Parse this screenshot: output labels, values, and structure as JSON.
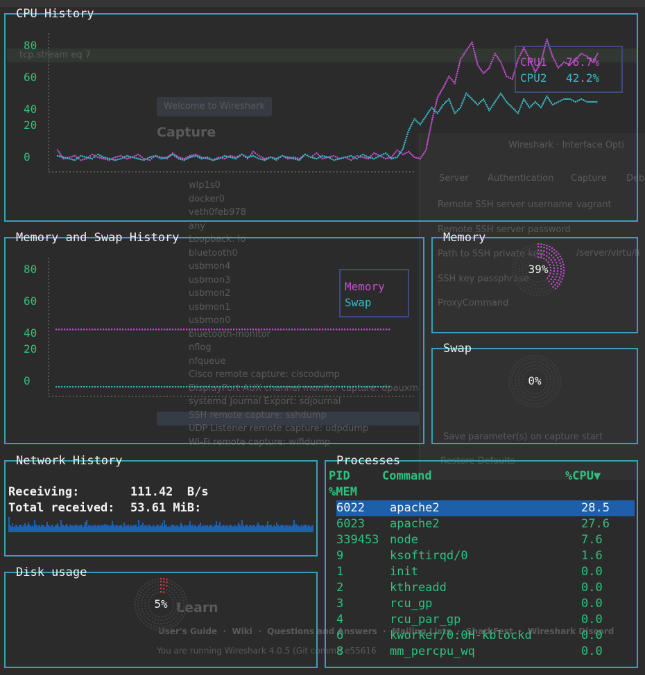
{
  "background_app": {
    "filter_text": "tcp.stream eq 7",
    "welcome": "Welcome to Wireshark",
    "capture_heading": "Capture",
    "learn_heading": "Learn",
    "learn_links": "User's Guide  ·  Wiki  ·  Questions and Answers  ·  Mailing Lists  ·  SharkFest  ·  Wireshark Discord",
    "version_text": "You are running Wireshark 4.0.5 (Git commit e55616",
    "interfaces": [
      "wlp1s0",
      "docker0",
      "veth0feb978",
      "any",
      "Loopback: lo",
      "bluetooth0",
      "usbmon4",
      "usbmon3",
      "usbmon2",
      "usbmon1",
      "usbmon0",
      "bluetooth-monitor",
      "nflog",
      "nfqueue",
      "Cisco remote capture: ciscodump",
      "DisplayPort AUX channel monitor capture: dpauxmon",
      "systemd Journal Export: sdjournal",
      "SSH remote capture: sshdump",
      "UDP Listener remote capture: udpdump",
      "Wi-Fi remote capture: wifidump"
    ],
    "dialog": {
      "title": "Wireshark · Interface Opti",
      "tabs": [
        "Server",
        "Authentication",
        "Capture",
        "Deb"
      ],
      "fields": [
        "Remote SSH server username",
        "Remote SSH server password",
        "Path to SSH private key",
        "SSH key passphrase",
        "ProxyCommand"
      ],
      "username_value": "vagrant",
      "key_path_value": "/server/virtu/li",
      "save_params": "Save parameter(s) on capture start",
      "restore": "Restore Defaults"
    }
  },
  "cpu_history": {
    "title": "CPU History",
    "ticks": [
      "80",
      "60",
      "40",
      "20",
      "0"
    ],
    "legend": [
      {
        "name": "CPU1",
        "value": "76.7%",
        "color": "#c44fd1"
      },
      {
        "name": "CPU2",
        "value": "42.2%",
        "color": "#3bb9c9"
      }
    ],
    "series": {
      "cpu1": [
        8,
        2,
        3,
        4,
        1,
        2,
        5,
        3,
        2,
        1,
        3,
        4,
        2,
        3,
        5,
        2,
        1,
        4,
        3,
        2,
        6,
        3,
        2,
        4,
        5,
        3,
        2,
        1,
        3,
        2,
        4,
        3,
        5,
        2,
        7,
        4,
        2,
        3,
        1,
        4,
        2,
        3,
        2,
        5,
        3,
        6,
        2,
        3,
        4,
        2,
        3,
        1,
        4,
        3,
        2,
        6,
        4,
        2,
        3,
        8,
        5,
        7,
        3,
        2,
        8,
        28,
        45,
        52,
        60,
        55,
        72,
        78,
        84,
        68,
        62,
        66,
        76,
        70,
        60,
        58,
        72,
        80,
        72,
        63,
        70,
        86,
        74,
        66,
        70,
        68,
        72,
        76,
        74,
        70,
        77
      ],
      "cpu2": [
        4,
        3,
        2,
        1,
        4,
        3,
        2,
        5,
        3,
        2,
        1,
        2,
        4,
        3,
        2,
        1,
        3,
        4,
        2,
        3,
        5,
        2,
        1,
        3,
        4,
        2,
        3,
        1,
        2,
        4,
        3,
        2,
        5,
        3,
        4,
        2,
        1,
        3,
        2,
        4,
        3,
        2,
        1,
        5,
        3,
        2,
        4,
        3,
        1,
        2,
        3,
        4,
        2,
        5,
        3,
        2,
        4,
        6,
        2,
        3,
        9,
        22,
        30,
        26,
        32,
        38,
        34,
        40,
        44,
        34,
        38,
        48,
        44,
        40,
        44,
        36,
        42,
        48,
        42,
        38,
        34,
        44,
        38,
        42,
        38,
        46,
        40,
        42,
        44,
        44,
        42,
        44,
        42,
        42,
        42
      ]
    }
  },
  "memory_history": {
    "title": "Memory and Swap History",
    "ticks": [
      "80",
      "60",
      "40",
      "20",
      "0"
    ],
    "legend": [
      {
        "name": "Memory",
        "color": "#c44fd1"
      },
      {
        "name": "Swap",
        "color": "#3bb9c9"
      }
    ],
    "memory_level": 39,
    "swap_level": 0
  },
  "memory": {
    "title": "Memory",
    "percent": "39%",
    "fraction": 0.39
  },
  "swap": {
    "title": "Swap",
    "percent": "0%",
    "fraction": 0.0
  },
  "network": {
    "title": "Network History",
    "receiving_label": "Receiving:",
    "receiving_value": "111.42  B/s",
    "total_label": "Total received:",
    "total_value": "53.61 MiB:",
    "bars": [
      6,
      6,
      5,
      8,
      5,
      5,
      7,
      6,
      5,
      6,
      7,
      6,
      5,
      6,
      8,
      5,
      6,
      6,
      7,
      6,
      5,
      6,
      5,
      6,
      7,
      5,
      6,
      6,
      5,
      7,
      6,
      6,
      5,
      6,
      7,
      6,
      6,
      5,
      7,
      6,
      5,
      6,
      7,
      8,
      6,
      5,
      6,
      6,
      7,
      5,
      6,
      5,
      6,
      5,
      7,
      6,
      6,
      5,
      6,
      7,
      6,
      6,
      5,
      6,
      7,
      6,
      5,
      6,
      7,
      6,
      5,
      6,
      6,
      5,
      6,
      5,
      7,
      6,
      5,
      6,
      6,
      5,
      7,
      6,
      6,
      5,
      6,
      7,
      6,
      5,
      6,
      6,
      5,
      7,
      5,
      6,
      6,
      5,
      6,
      6,
      7,
      5,
      6,
      6,
      5,
      6,
      7,
      5,
      6,
      6,
      5,
      6,
      6,
      7,
      5,
      6,
      5,
      6,
      7,
      6,
      5,
      6,
      6,
      5,
      7,
      6,
      6,
      5,
      6,
      6,
      5,
      6,
      7,
      6,
      5,
      6,
      6,
      5,
      6,
      7,
      6,
      5,
      6,
      5,
      6,
      7,
      6,
      6,
      5,
      6,
      6,
      5,
      6,
      6,
      7,
      5,
      6,
      6,
      5,
      6,
      6,
      5,
      6,
      7,
      5,
      6,
      6,
      5,
      6,
      7,
      6,
      5,
      6,
      6,
      5,
      6,
      6,
      5,
      6,
      6,
      7,
      5,
      6,
      6,
      5,
      6,
      6,
      7,
      6,
      5,
      6,
      6,
      5,
      6,
      6,
      5,
      7,
      6,
      6,
      5,
      6,
      6,
      5,
      6,
      6,
      7,
      5,
      6,
      6,
      5,
      6,
      7,
      6,
      5,
      6,
      6,
      5,
      6,
      6,
      5,
      6,
      6,
      7,
      6,
      5,
      6,
      6,
      5,
      6,
      6,
      5,
      6,
      6,
      7,
      5,
      6,
      6,
      5,
      6,
      6,
      5,
      6,
      6,
      7,
      6,
      5,
      6,
      6,
      5,
      6,
      6,
      5,
      6,
      6,
      6,
      5,
      6,
      6,
      5,
      6,
      6,
      5,
      6,
      7,
      6,
      5,
      6,
      6,
      5,
      6,
      6
    ]
  },
  "disk": {
    "title": "Disk usage",
    "percent": "5%",
    "fraction": 0.05
  },
  "processes": {
    "title": "Processes",
    "header": {
      "pid": "PID",
      "command": "Command",
      "cpu": "%CPU▼",
      "mem": "%MEM"
    },
    "rows": [
      {
        "pid": "6022",
        "command": "apache2",
        "cpu": "28.5",
        "selected": true
      },
      {
        "pid": "6023",
        "command": "apache2",
        "cpu": "27.6"
      },
      {
        "pid": "339453",
        "command": "node",
        "cpu": "7.6"
      },
      {
        "pid": "9",
        "command": "ksoftirqd/0",
        "cpu": "1.6"
      },
      {
        "pid": "1",
        "command": "init",
        "cpu": "0.0"
      },
      {
        "pid": "2",
        "command": "kthreadd",
        "cpu": "0.0"
      },
      {
        "pid": "3",
        "command": "rcu_gp",
        "cpu": "0.0"
      },
      {
        "pid": "4",
        "command": "rcu_par_gp",
        "cpu": "0.0"
      },
      {
        "pid": "6",
        "command": "kworker/0:0H-kblockd",
        "cpu": "0.0"
      },
      {
        "pid": "8",
        "command": "mm_percpu_wq",
        "cpu": "0.0"
      }
    ]
  }
}
